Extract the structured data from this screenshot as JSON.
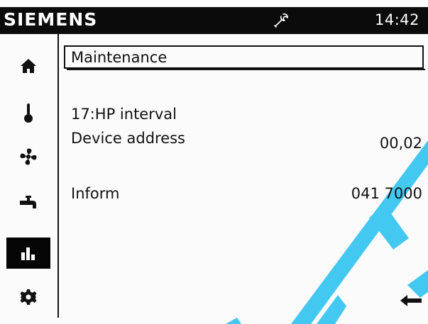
{
  "header": {
    "brand": "SIEMENS",
    "tools_icon": "wrench-icon",
    "time": "14:42"
  },
  "sidebar": {
    "items": [
      {
        "icon": "home-icon",
        "active": false
      },
      {
        "icon": "thermometer-icon",
        "active": false
      },
      {
        "icon": "fan-icon",
        "active": false
      },
      {
        "icon": "faucet-icon",
        "active": false
      },
      {
        "icon": "bar-chart-icon",
        "active": true
      },
      {
        "icon": "gear-icon",
        "active": false
      }
    ]
  },
  "main": {
    "title": "Maintenance",
    "rows": [
      {
        "label": "17:HP interval",
        "value": ""
      },
      {
        "label": "Device address",
        "value": "00,02"
      },
      {
        "label": "Inform",
        "value": "041 7000"
      }
    ],
    "back_icon": "back-arrow-icon"
  },
  "colors": {
    "header_background": "#0b0b0b",
    "screen_background": "#fbfbfb",
    "watermark": "#43c8f2"
  }
}
